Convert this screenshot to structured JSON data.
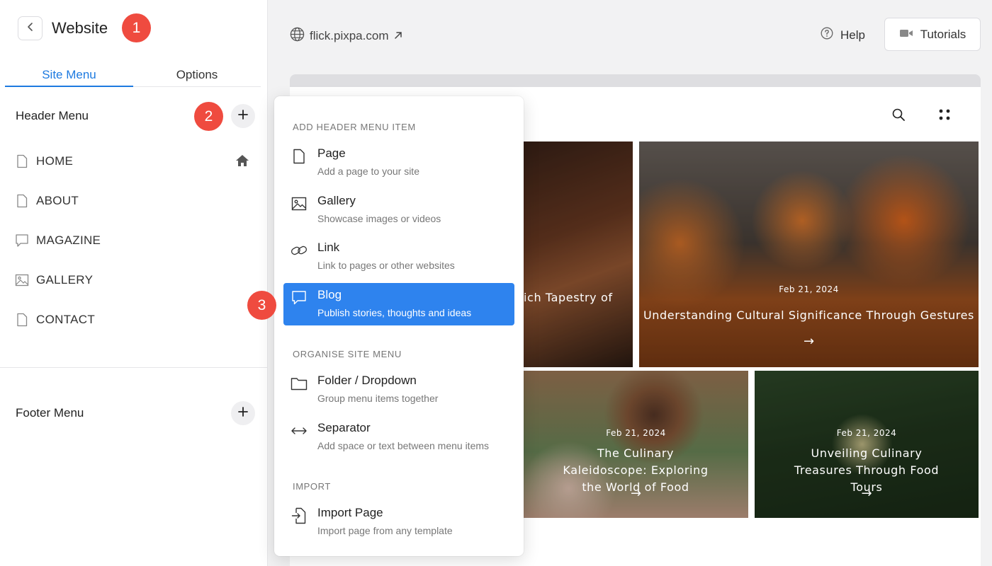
{
  "sidebar": {
    "title": "Website",
    "tabs": [
      {
        "label": "Site Menu",
        "active": true
      },
      {
        "label": "Options",
        "active": false
      }
    ],
    "header_menu": {
      "title": "Header Menu",
      "items": [
        {
          "label": "HOME",
          "icon": "page-icon",
          "is_home": true
        },
        {
          "label": "ABOUT",
          "icon": "page-icon"
        },
        {
          "label": "MAGAZINE",
          "icon": "blog-icon"
        },
        {
          "label": "GALLERY",
          "icon": "gallery-icon"
        },
        {
          "label": "CONTACT",
          "icon": "page-icon"
        }
      ]
    },
    "footer_menu": {
      "title": "Footer Menu"
    }
  },
  "markers": [
    "1",
    "2",
    "3"
  ],
  "topbar": {
    "url": "flick.pixpa.com",
    "help_label": "Help",
    "tutorials_label": "Tutorials"
  },
  "dropdown": {
    "sections": [
      {
        "heading": "ADD HEADER MENU ITEM",
        "items": [
          {
            "title": "Page",
            "subtitle": "Add a page to your site",
            "icon": "page-icon"
          },
          {
            "title": "Gallery",
            "subtitle": "Showcase images or videos",
            "icon": "gallery-icon"
          },
          {
            "title": "Link",
            "subtitle": "Link to pages or other websites",
            "icon": "link-icon"
          },
          {
            "title": "Blog",
            "subtitle": "Publish stories, thoughts and ideas",
            "icon": "blog-icon",
            "selected": true
          }
        ]
      },
      {
        "heading": "ORGANISE SITE MENU",
        "items": [
          {
            "title": "Folder / Dropdown",
            "subtitle": "Group menu items together",
            "icon": "folder-icon"
          },
          {
            "title": "Separator",
            "subtitle": "Add space or text between menu items",
            "icon": "separator-icon"
          }
        ]
      },
      {
        "heading": "IMPORT",
        "items": [
          {
            "title": "Import Page",
            "subtitle": "Import page from any template",
            "icon": "import-icon"
          }
        ]
      }
    ]
  },
  "preview": {
    "cards": [
      {
        "date": "",
        "title": "ich Tapestry of"
      },
      {
        "date": "Feb 21, 2024",
        "title": "Understanding Cultural Significance Through Gestures",
        "arrow": "→"
      },
      {
        "date": "Feb 21, 2024",
        "title": "The Culinary Kaleidoscope: Exploring the World of Food",
        "arrow": "→"
      },
      {
        "date": "Feb 21, 2024",
        "title": "Unveiling Culinary Treasures Through Food Tours",
        "arrow": "→"
      }
    ]
  },
  "colors": {
    "accent": "#1d7ae0",
    "selected_bg": "#2e83ee",
    "marker": "#ef4b3f"
  }
}
